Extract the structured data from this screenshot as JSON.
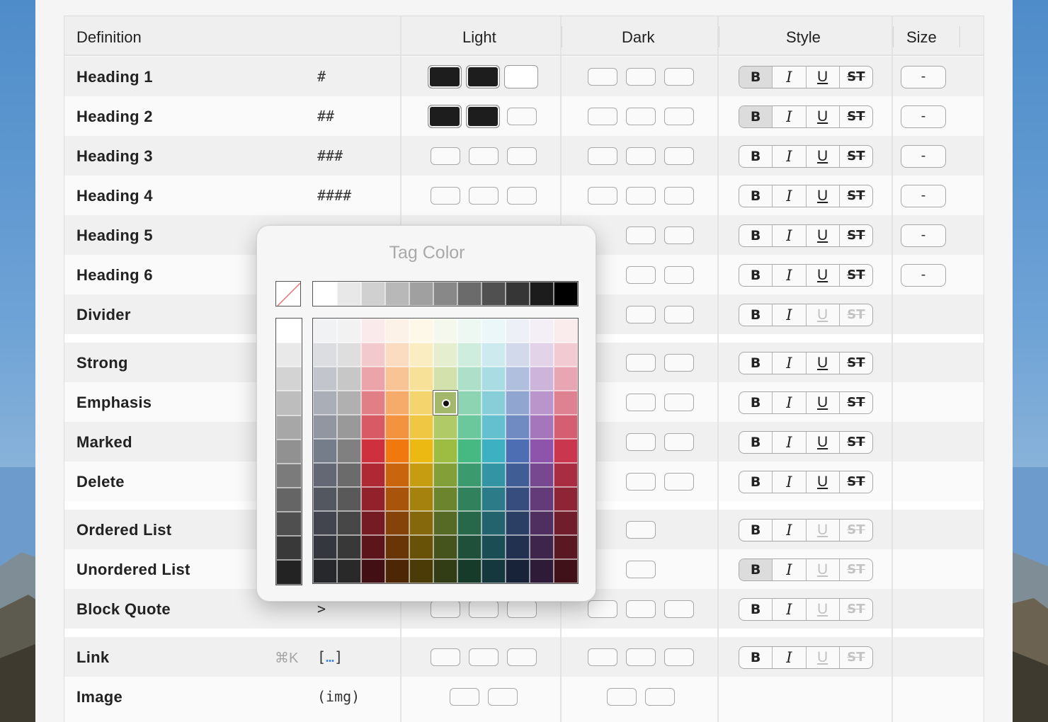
{
  "header": {
    "definition": "Definition",
    "light": "Light",
    "dark": "Dark",
    "style": "Style",
    "size": "Size"
  },
  "rows": [
    {
      "name": "Heading 1",
      "md": "#",
      "size": "-"
    },
    {
      "name": "Heading 2",
      "md": "##",
      "size": "-"
    },
    {
      "name": "Heading 3",
      "md": "###",
      "size": "-"
    },
    {
      "name": "Heading 4",
      "md": "####",
      "size": "-"
    },
    {
      "name": "Heading 5",
      "size": "-"
    },
    {
      "name": "Heading 6",
      "size": "-"
    },
    {
      "name": "Divider"
    },
    {
      "name": "Strong"
    },
    {
      "name": "Emphasis"
    },
    {
      "name": "Marked"
    },
    {
      "name": "Delete"
    },
    {
      "name": "Ordered List"
    },
    {
      "name": "Unordered List"
    },
    {
      "name": "Block Quote",
      "md": ">"
    },
    {
      "name": "Link",
      "md_prefix": "[",
      "md_dots": "…",
      "md_suffix": "]",
      "shortcut": "⌘K"
    },
    {
      "name": "Image",
      "md": "(img)"
    }
  ],
  "style_buttons": {
    "bold": "B",
    "italic": "I",
    "underline": "U",
    "strike": "ST"
  },
  "popup": {
    "title": "Tag Color",
    "selected_color": "#a3b86b",
    "grays": [
      "#ffffff",
      "#e8e8e8",
      "#d0d0d0",
      "#b8b8b8",
      "#a0a0a0",
      "#888888",
      "#6b6b6b",
      "#505050",
      "#363636",
      "#1c1c1c",
      "#000000"
    ]
  }
}
